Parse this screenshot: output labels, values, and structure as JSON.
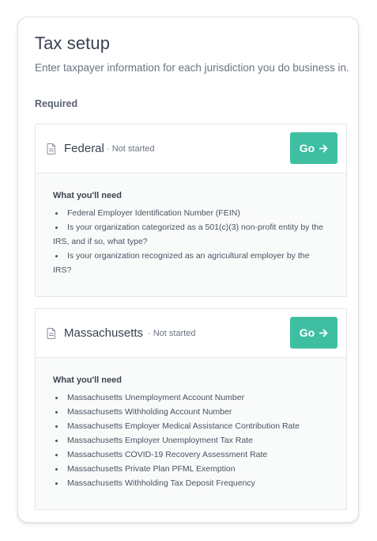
{
  "header": {
    "title": "Tax setup",
    "subtitle": "Enter taxpayer information for each jurisdiction you do business in."
  },
  "section": {
    "label": "Required"
  },
  "jurisdictions": [
    {
      "name": "Federal",
      "status": "· Not started",
      "go_label": "Go",
      "needs_title": "What you'll need",
      "requirements": [
        "Federal Employer Identification Number (FEIN)",
        "Is your organization categorized as a 501(c)(3) non-profit entity by the IRS, and if so, what type?",
        "Is your organization recognized as an agricultural employer by the IRS?"
      ]
    },
    {
      "name": "Massachusetts",
      "status": "· Not started",
      "go_label": "Go",
      "needs_title": "What you'll need",
      "requirements": [
        "Massachusetts Unemployment Account Number",
        "Massachusetts Withholding Account Number",
        "Massachusetts Employer Medical Assistance Contribution Rate",
        "Massachusetts Employer Unemployment Tax Rate",
        "Massachusetts COVID-19 Recovery Assessment Rate",
        "Massachusetts Private Plan PFML Exemption",
        "Massachusetts Withholding Tax Deposit Frequency"
      ]
    }
  ],
  "icons": {
    "card_icon": "document-icon",
    "button_icon": "arrow-right-icon"
  },
  "colors": {
    "accent": "#3ebfa2",
    "text": "#3a4150",
    "muted": "#6b7380"
  }
}
